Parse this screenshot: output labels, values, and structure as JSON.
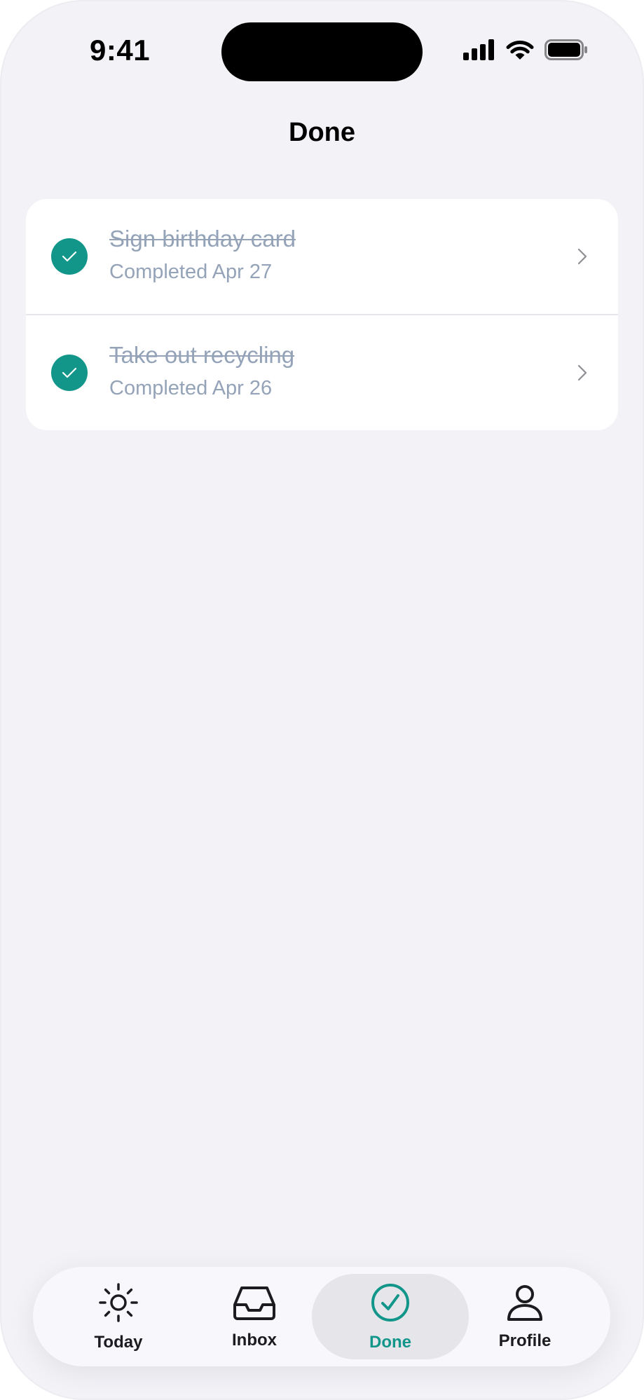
{
  "status_bar": {
    "time": "9:41",
    "icons": [
      "cellular-signal-icon",
      "wifi-icon",
      "battery-icon"
    ]
  },
  "nav": {
    "title": "Done"
  },
  "completed_tasks": [
    {
      "title": "Sign birthday card",
      "subtitle": "Completed Apr 27"
    },
    {
      "title": "Take out recycling",
      "subtitle": "Completed Apr 26"
    }
  ],
  "tab_bar": {
    "tabs": [
      {
        "label": "Today",
        "icon": "sun-icon",
        "active": false
      },
      {
        "label": "Inbox",
        "icon": "inbox-tray-icon",
        "active": false
      },
      {
        "label": "Done",
        "icon": "check-circle-icon",
        "active": true
      },
      {
        "label": "Profile",
        "icon": "person-icon",
        "active": false
      }
    ]
  },
  "colors": {
    "accent": "#12968a",
    "background": "#f2f2f7",
    "muted_text": "#94a3b8"
  }
}
